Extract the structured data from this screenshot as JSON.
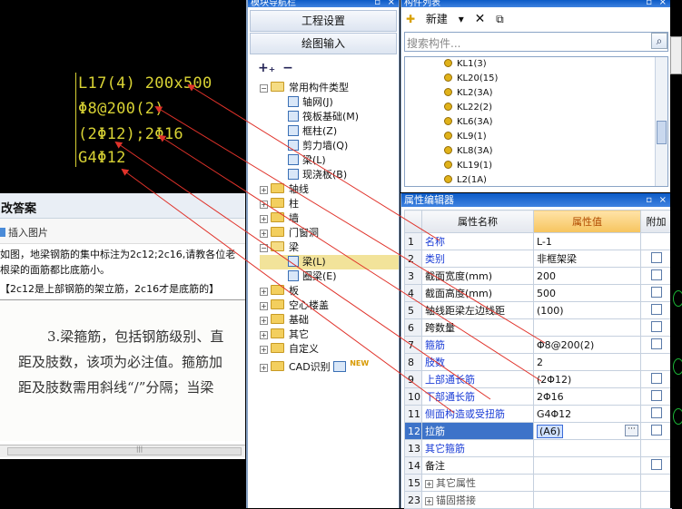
{
  "cad": {
    "labels": [
      "L17(4) 200x500",
      "Φ8@200(2)",
      "(2Φ12);2Φ16",
      "G4Φ12"
    ]
  },
  "answer_panel": {
    "title": "改答案",
    "insert_image": "插入图片",
    "line1": "如图，地梁钢筋的集中标注为2c12;2c16,请教各位老",
    "line2": "根梁的面筋都比底筋小。",
    "highlight": "【2c12是上部钢筋的架立筋，2c16才是底筋的】",
    "scan_lines": [
      "3.梁箍筋，包括钢筋级别、直",
      "距及肢数，该项为必注值。箍筋加",
      "距及肢数需用斜线“/”分隔；当梁"
    ]
  },
  "nav": {
    "title": "模块导航栏",
    "btn_project": "工程设置",
    "btn_drawing": "绘图输入",
    "tree": {
      "common": "常用构件类型",
      "common_children": [
        "轴网(J)",
        "筏板基础(M)",
        "框柱(Z)",
        "剪力墙(Q)",
        "梁(L)",
        "现浇板(B)"
      ],
      "axis": "轴线",
      "column": "柱",
      "wall": "墙",
      "door": "门窗洞",
      "beam": "梁",
      "beam_children": [
        "梁(L)",
        "圈梁(E)"
      ],
      "slab": "板",
      "hollow": "空心楼盖",
      "foundation": "基础",
      "other": "其它",
      "custom": "自定义",
      "cad": "CAD识别",
      "new_badge": "NEW"
    }
  },
  "component_list": {
    "title": "构件列表",
    "new_label": "新建",
    "search_placeholder": "搜索构件...",
    "items": [
      "KL1(3)",
      "KL20(15)",
      "KL2(3A)",
      "KL22(2)",
      "KL6(3A)",
      "KL9(1)",
      "KL8(3A)",
      "KL19(1)",
      "L2(1A)"
    ]
  },
  "props": {
    "title": "属性编辑器",
    "headers": {
      "name": "属性名称",
      "value": "属性值",
      "extra": "附加"
    },
    "rows": [
      {
        "n": "1",
        "name": "名称",
        "value": "L-1"
      },
      {
        "n": "2",
        "name": "类别",
        "value": "非框架梁"
      },
      {
        "n": "3",
        "name": "截面宽度(mm)",
        "value": "200"
      },
      {
        "n": "4",
        "name": "截面高度(mm)",
        "value": "500"
      },
      {
        "n": "5",
        "name": "轴线距梁左边线距",
        "value": "(100)"
      },
      {
        "n": "6",
        "name": "跨数量",
        "value": ""
      },
      {
        "n": "7",
        "name": "箍筋",
        "value": "Φ8@200(2)"
      },
      {
        "n": "8",
        "name": "肢数",
        "value": "2"
      },
      {
        "n": "9",
        "name": "上部通长筋",
        "value": "(2Φ12)"
      },
      {
        "n": "10",
        "name": "下部通长筋",
        "value": "2Φ16"
      },
      {
        "n": "11",
        "name": "侧面构造或受扭筋",
        "value": "G4Φ12"
      },
      {
        "n": "12",
        "name": "拉筋",
        "value": "(A6)"
      },
      {
        "n": "13",
        "name": "其它箍筋",
        "value": ""
      },
      {
        "n": "14",
        "name": "备注",
        "value": ""
      },
      {
        "n": "15",
        "name": "其它属性",
        "value": ""
      },
      {
        "n": "23",
        "name": "锚固搭接",
        "value": ""
      }
    ]
  },
  "colors": {
    "arrow": "#e0322a",
    "cad_text": "#d8d234",
    "selected_row": "#3d73c9"
  }
}
